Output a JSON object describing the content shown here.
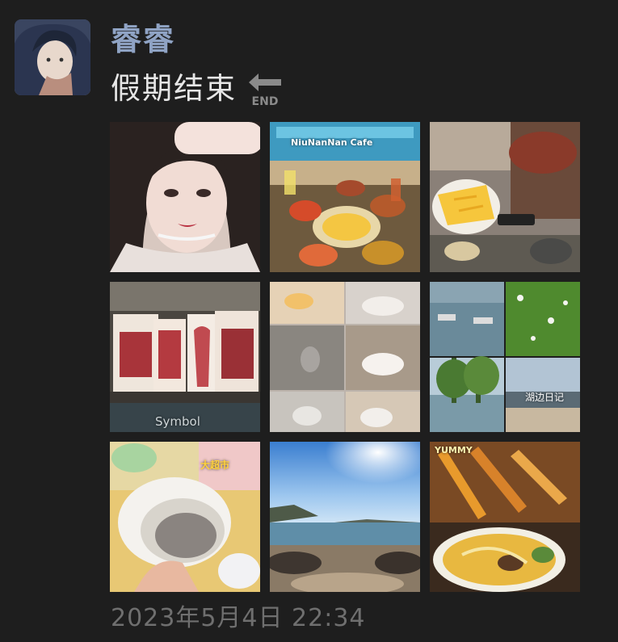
{
  "post": {
    "username": "睿睿",
    "text": "假期结束",
    "end_badge": "END",
    "timestamp": "2023年5月4日 22:34"
  },
  "photos": [
    {
      "subject": "selfie portrait"
    },
    {
      "subject": "cafe food table",
      "caption": "NiuNanNan Cafe"
    },
    {
      "subject": "mango and roasted meat dishes"
    },
    {
      "subject": "paper cut art cards",
      "caption": "Symbol"
    },
    {
      "subject": "cats collage"
    },
    {
      "subject": "lake and flowers collage",
      "caption": "湖边日记"
    },
    {
      "subject": "hand holding shoe",
      "caption": "大超市"
    },
    {
      "subject": "seaside rocks under blue sky"
    },
    {
      "subject": "fried skewers and noodle soup",
      "caption": "YUMMY"
    }
  ],
  "colors": {
    "background": "#1e1e1e",
    "username": "#8fa3c4",
    "text": "#e6e6e6",
    "timestamp": "#6f6f6f"
  }
}
